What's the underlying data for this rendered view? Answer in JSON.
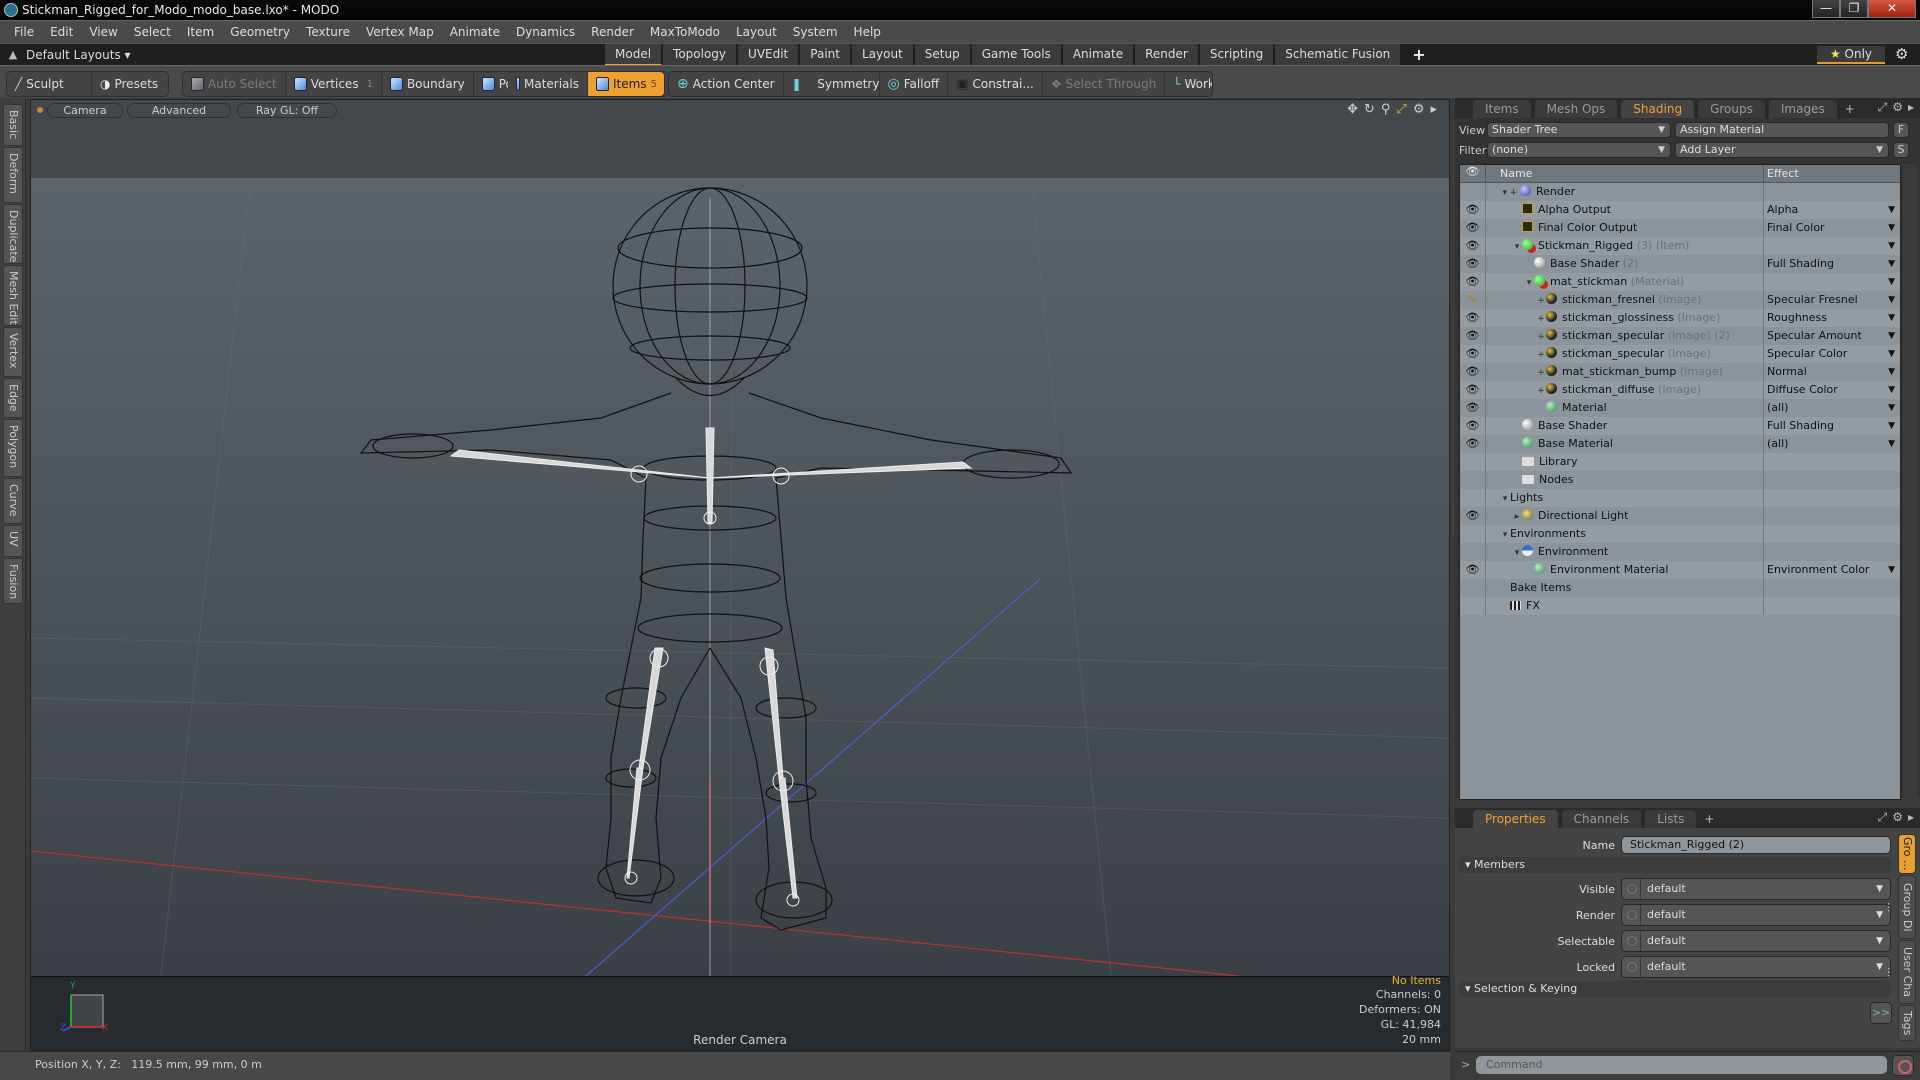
{
  "window": {
    "title": "Stickman_Rigged_for_Modo_modo_base.lxo* - MODO",
    "controls": [
      "minimize",
      "restore",
      "close"
    ]
  },
  "menubar": {
    "items": [
      "File",
      "Edit",
      "View",
      "Select",
      "Item",
      "Geometry",
      "Texture",
      "Vertex Map",
      "Animate",
      "Dynamics",
      "Render",
      "MaxToModo",
      "Layout",
      "System",
      "Help"
    ]
  },
  "layoutbar": {
    "layouts_label": "Default Layouts ▾",
    "tabs": [
      "Model",
      "Topology",
      "UVEdit",
      "Paint",
      "Layout",
      "Setup",
      "Game Tools",
      "Animate",
      "Render",
      "Scripting",
      "Schematic Fusion"
    ],
    "active_tab": "Model",
    "add_tab": "+",
    "only_label": "Only"
  },
  "toolbar": {
    "sculpt": "Sculpt",
    "presets": "Presets",
    "auto_select": "Auto Select",
    "vertices": "Vertices",
    "vertices_count": "1",
    "boundary": "Boundary",
    "polygons": "Polygons",
    "materials": "Materials",
    "items": "Items",
    "items_count": "5",
    "action_center": "Action Center",
    "symmetry": "Symmetry",
    "falloff": "Falloff",
    "constraints": "Constrai...",
    "select_through": "Select Through",
    "workplane": "WorkPlane"
  },
  "left_tabs": [
    "Basic",
    "Deform",
    "Duplicate",
    "Mesh Edit",
    "Vertex",
    "Edge",
    "Polygon",
    "Curve",
    "UV",
    "Fusion"
  ],
  "viewport": {
    "camera_btn": "Camera",
    "advanced_btn": "Advanced",
    "raygl_btn": "Ray GL: Off",
    "camera_name": "Render Camera",
    "info": {
      "items": "No Items",
      "channels": "Channels: 0",
      "deformers": "Deformers: ON",
      "gl": "GL: 41,984",
      "scale": "20 mm"
    },
    "axis_labels": {
      "x": "X",
      "y": "Y",
      "z": "Z"
    }
  },
  "shading_panel": {
    "tabs": [
      "Items",
      "Mesh Ops",
      "Shading",
      "Groups",
      "Images"
    ],
    "active_tab": "Shading",
    "add_tab": "+",
    "view_label": "View",
    "view_value": "Shader Tree",
    "assign_material": "Assign Material",
    "f_btn": "F",
    "filter_label": "Filter",
    "filter_value": "(none)",
    "add_layer": "Add Layer",
    "s_btn": "S",
    "columns": {
      "name": "Name",
      "effect": "Effect"
    },
    "rows": [
      {
        "indent": 0,
        "twist": "▾ +",
        "icon": "render",
        "name": "Render",
        "sub": "",
        "effect": "",
        "eye": false,
        "dropdown": false
      },
      {
        "indent": 1,
        "twist": "",
        "icon": "out",
        "name": "Alpha Output",
        "sub": "",
        "effect": "Alpha",
        "eye": true,
        "dropdown": true
      },
      {
        "indent": 1,
        "twist": "",
        "icon": "out",
        "name": "Final Color Output",
        "sub": "",
        "effect": "Final Color",
        "eye": true,
        "dropdown": true
      },
      {
        "indent": 1,
        "twist": "▾",
        "icon": "grp",
        "name": "Stickman_Rigged",
        "sub": " (3) (Item)",
        "effect": "",
        "eye": true,
        "dropdown": true
      },
      {
        "indent": 2,
        "twist": "",
        "icon": "shader",
        "name": "Base Shader",
        "sub": " (2)",
        "effect": "Full Shading",
        "eye": true,
        "dropdown": true
      },
      {
        "indent": 2,
        "twist": "▾",
        "icon": "grp",
        "name": "mat_stickman",
        "sub": " (Material)",
        "effect": "",
        "eye": true,
        "dropdown": true
      },
      {
        "indent": 3,
        "twist": "+",
        "icon": "img",
        "name": "stickman_fresnel",
        "sub": " (Image)",
        "effect": "Specular Fresnel",
        "eye": "brush",
        "dropdown": true
      },
      {
        "indent": 3,
        "twist": "+",
        "icon": "img",
        "name": "stickman_glossiness",
        "sub": " (Image)",
        "effect": "Roughness",
        "eye": true,
        "dropdown": true
      },
      {
        "indent": 3,
        "twist": "+",
        "icon": "img",
        "name": "stickman_specular",
        "sub": " (Image) (2)",
        "effect": "Specular Amount",
        "eye": true,
        "dropdown": true
      },
      {
        "indent": 3,
        "twist": "+",
        "icon": "img",
        "name": "stickman_specular",
        "sub": " (Image)",
        "effect": "Specular Color",
        "eye": true,
        "dropdown": true
      },
      {
        "indent": 3,
        "twist": "+",
        "icon": "img",
        "name": "mat_stickman_bump",
        "sub": " (Image)",
        "effect": "Normal",
        "eye": true,
        "dropdown": true
      },
      {
        "indent": 3,
        "twist": "+",
        "icon": "img",
        "name": "stickman_diffuse",
        "sub": " (Image)",
        "effect": "Diffuse Color",
        "eye": true,
        "dropdown": true
      },
      {
        "indent": 3,
        "twist": "",
        "icon": "mat",
        "name": "Material",
        "sub": "",
        "effect": "(all)",
        "eye": true,
        "dropdown": true
      },
      {
        "indent": 1,
        "twist": "",
        "icon": "shader",
        "name": "Base Shader",
        "sub": "",
        "effect": "Full Shading",
        "eye": true,
        "dropdown": true
      },
      {
        "indent": 1,
        "twist": "",
        "icon": "mat",
        "name": "Base Material",
        "sub": "",
        "effect": "(all)",
        "eye": true,
        "dropdown": true
      },
      {
        "indent": 1,
        "twist": "",
        "icon": "folder",
        "name": "Library",
        "sub": "",
        "effect": "",
        "eye": false,
        "dropdown": false
      },
      {
        "indent": 1,
        "twist": "",
        "icon": "folder",
        "name": "Nodes",
        "sub": "",
        "effect": "",
        "eye": false,
        "dropdown": false
      },
      {
        "indent": 0,
        "twist": "▾",
        "icon": "",
        "name": "Lights",
        "sub": "",
        "effect": "",
        "eye": false,
        "dropdown": false
      },
      {
        "indent": 1,
        "twist": "▸",
        "icon": "light",
        "name": "Directional Light",
        "sub": "",
        "effect": "",
        "eye": true,
        "dropdown": false
      },
      {
        "indent": 0,
        "twist": "▾",
        "icon": "",
        "name": "Environments",
        "sub": "",
        "effect": "",
        "eye": false,
        "dropdown": false
      },
      {
        "indent": 1,
        "twist": "▾",
        "icon": "env",
        "name": "Environment",
        "sub": "",
        "effect": "",
        "eye": false,
        "dropdown": false
      },
      {
        "indent": 2,
        "twist": "",
        "icon": "mat",
        "name": "Environment Material",
        "sub": "",
        "effect": "Environment Color",
        "eye": true,
        "dropdown": true
      },
      {
        "indent": 0,
        "twist": "",
        "icon": "",
        "name": "Bake Items",
        "sub": "",
        "effect": "",
        "eye": false,
        "dropdown": false
      },
      {
        "indent": 0,
        "twist": "",
        "icon": "fx",
        "name": "FX",
        "sub": "",
        "effect": "",
        "eye": false,
        "dropdown": false
      }
    ]
  },
  "properties_panel": {
    "tabs": [
      "Properties",
      "Channels",
      "Lists"
    ],
    "active_tab": "Properties",
    "add_tab": "+",
    "name_label": "Name",
    "name_value": "Stickman_Rigged (2)",
    "members_section": "Members",
    "fields": [
      {
        "label": "Visible",
        "value": "default"
      },
      {
        "label": "Render",
        "value": "default"
      },
      {
        "label": "Selectable",
        "value": "default"
      },
      {
        "label": "Locked",
        "value": "default"
      }
    ],
    "selection_section": "Selection & Keying",
    "more_btn": ">>",
    "side_tabs": [
      "Gro ...",
      "Group Di ...",
      "User Cha ...",
      "Tags"
    ]
  },
  "statusbar": {
    "position": "Position X, Y, Z:   119.5 mm, 99 mm, 0 m"
  },
  "command": {
    "prompt": ">",
    "placeholder": "Command"
  },
  "colors": {
    "accent": "#f0a030",
    "x_axis": "#c03030",
    "y_axis": "#30a030",
    "z_axis": "#3050d0"
  }
}
